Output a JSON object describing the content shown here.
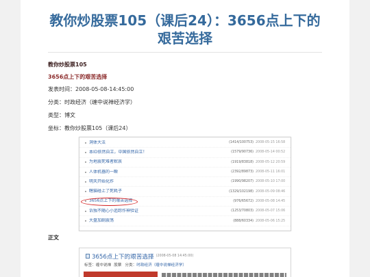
{
  "page": {
    "title": "教你炒股票105（课后24）：3656点上下的艰苦选择"
  },
  "post": {
    "series": "教你炒股票105",
    "subtitle": "3656点上下的艰苦选择",
    "published": "发表时间：2008-05-08-14:45:00",
    "category": "分类：时政经济（缠中说禅经济学）",
    "type": "类型：博文",
    "coordinate": "坐标：教你炒股票105（课后24）",
    "body_heading": "正文"
  },
  "article_list_image": {
    "items": [
      {
        "title": "洞体大法",
        "stats": "(1414/100753)",
        "date": "2008-05-15 16:58"
      },
      {
        "title": "本ID依然自立，中国依然自立！",
        "stats": "(1579/90736)",
        "date": "2008-05-14 00:52"
      },
      {
        "title": "为地震死难者默哀",
        "stats": "(1919/83818)",
        "date": "2008-05-12 20:59"
      },
      {
        "title": "人体机器的一瞬",
        "stats": "(2392/89873)",
        "date": "2008-05-11 16:01"
      },
      {
        "title": "明天开始化炸",
        "stats": "(1990/98207)",
        "date": "2008-05-10 17:00"
      },
      {
        "title": "瞎猫碰上了死耗子",
        "stats": "(1329/102198)",
        "date": "2008-05-09 08:46"
      },
      {
        "title": "3656点上下的艰苦选择",
        "stats": "(976/65672)",
        "date": "2008-05-08 14:45",
        "circled": true
      },
      {
        "title": "诉独不随心小追踪作神验证",
        "stats": "(1253/70803)",
        "date": "2008-05-07 15:06"
      },
      {
        "title": "大盘加剧震荡",
        "stats": "(888/60334)",
        "date": "2008-05-06 15:25"
      }
    ]
  },
  "blog_header_image": {
    "title": "3656点上下的艰苦选择",
    "date": "(2008-05-08 14:45:00)",
    "tags_label": "标签：",
    "tags": [
      "缠中说禅",
      "股票"
    ],
    "category_label": "分类：",
    "category": "时政经济（缠中说禅经济学）"
  },
  "icons": {
    "list_bullet": "bullet-icon",
    "post_title": "article-icon"
  },
  "colors": {
    "page_background": "#f1f1f1",
    "title_blue": "#356a9c",
    "link_blue": "#3466a8",
    "label_dark": "#3b1e1e",
    "label_red": "#8b2a2a",
    "highlight_red": "#d41f1f",
    "quote_red": "#c0392b"
  }
}
